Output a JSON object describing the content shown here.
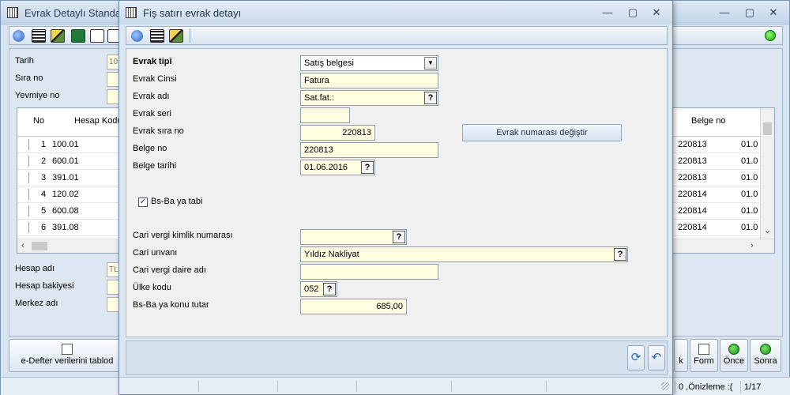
{
  "background_window": {
    "title": "Evrak Detaylı Standart",
    "labels": {
      "tarih": "Tarih",
      "sira_no": "Sıra no",
      "yevmiye_no": "Yevmiye no",
      "hesap_adi": "Hesap adı",
      "hesap_bakiyesi": "Hesap bakiyesi",
      "merkez_adi": "Merkez adı"
    },
    "tarih_value": "10",
    "hesap_adi_value": "TL",
    "grid": {
      "columns": {
        "no": "No",
        "hesap_kodu": "Hesap Kodu",
        "belge_no": "Belge no"
      },
      "rows": [
        {
          "no": "1",
          "hesap": "100.01",
          "belge": "220813",
          "tarih": "01.0"
        },
        {
          "no": "2",
          "hesap": "600.01",
          "belge": "220813",
          "tarih": "01.0"
        },
        {
          "no": "3",
          "hesap": "391.01",
          "belge": "220813",
          "tarih": "01.0"
        },
        {
          "no": "4",
          "hesap": "120.02",
          "belge": "220814",
          "tarih": "01.0"
        },
        {
          "no": "5",
          "hesap": "600.08",
          "belge": "220814",
          "tarih": "01.0"
        },
        {
          "no": "6",
          "hesap": "391.08",
          "belge": "220814",
          "tarih": "01.0"
        }
      ]
    },
    "footer_buttons": {
      "edefter": "e-Defter verilerini tablod",
      "k": "k",
      "form": "Form",
      "once": "Önce",
      "sonra": "Sonra"
    },
    "status": {
      "onizleme": "0 ,Önizleme :(",
      "page": "1/17"
    }
  },
  "dialog": {
    "title": "Fiş satırı evrak detayı",
    "fields": {
      "evrak_tipi": {
        "label": "Evrak tipi",
        "value": "Satış belgesi"
      },
      "evrak_cinsi": {
        "label": "Evrak Cinsi",
        "value": "Fatura"
      },
      "evrak_adi": {
        "label": "Evrak adı",
        "value": "Sat.fat.:"
      },
      "evrak_seri": {
        "label": "Evrak seri",
        "value": ""
      },
      "evrak_sira_no": {
        "label": "Evrak sıra no",
        "value": "220813"
      },
      "belge_no": {
        "label": "Belge no",
        "value": "220813"
      },
      "belge_tarihi": {
        "label": "Belge tarihi",
        "value": "01.06.2016"
      },
      "bsba_tabi": {
        "label": "Bs-Ba ya tabi",
        "checked": true
      },
      "cari_vergi_kimlik": {
        "label": "Cari vergi kimlik numarası",
        "value": ""
      },
      "cari_unvani": {
        "label": "Cari unvanı",
        "value": "Yıldız Nakliyat"
      },
      "cari_vergi_daire": {
        "label": "Cari vergi daire adı",
        "value": ""
      },
      "ulke_kodu": {
        "label": "Ülke kodu",
        "value": "052"
      },
      "bsba_tutar": {
        "label": "Bs-Ba ya konu tutar",
        "value": "685,00"
      }
    },
    "change_number_button": "Evrak numarası değiştir",
    "check_mark": "✓",
    "question_mark": "?",
    "dropdown_arrow": "▼"
  },
  "window_controls": {
    "minimize": "—",
    "maximize": "▢",
    "close": "✕"
  },
  "colors": {
    "field_bg": "#fffde0",
    "accent": "#2a67b8",
    "status_green": "#1b9b1b"
  }
}
